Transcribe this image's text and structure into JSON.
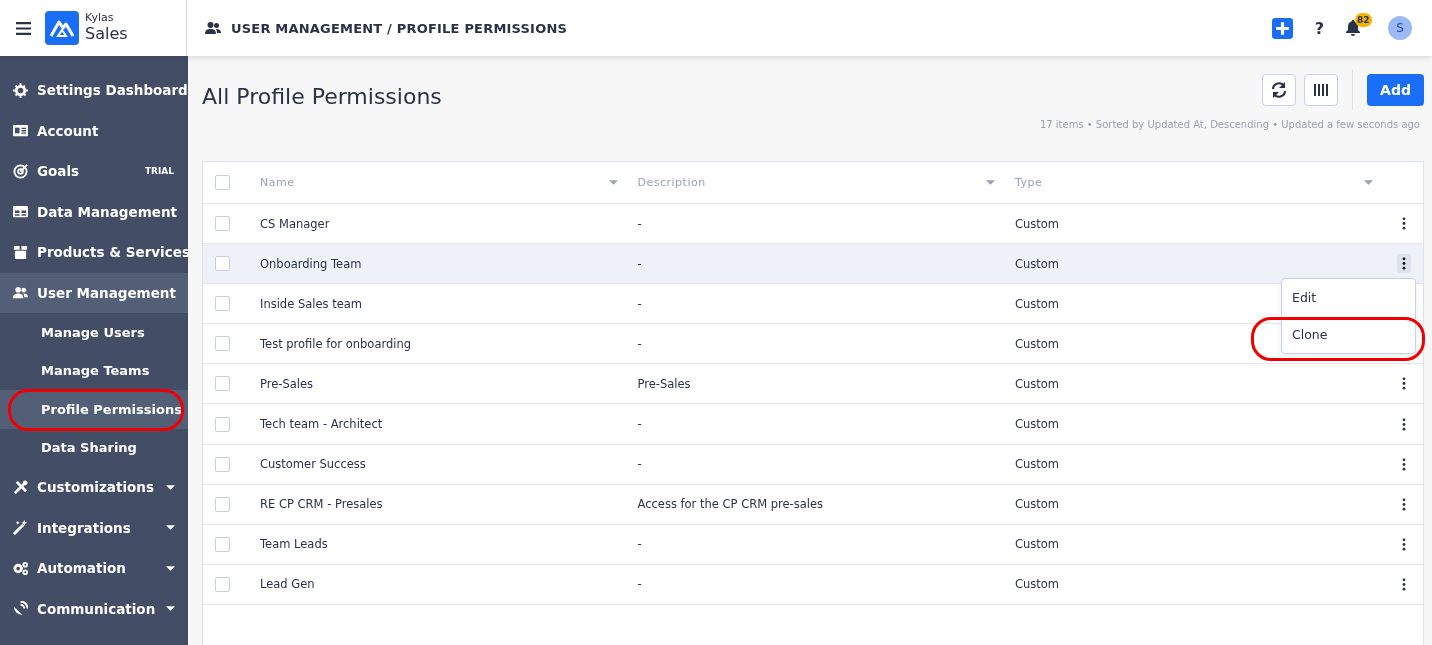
{
  "header": {
    "brand_top": "Kylas",
    "brand_bottom": "Sales",
    "breadcrumb": "USER MANAGEMENT / PROFILE PERMISSIONS",
    "help": "?",
    "notification_count": "82",
    "avatar": "S"
  },
  "sidebar": {
    "items": [
      {
        "kind": "link",
        "label": "Settings Dashboard",
        "expanded": false
      },
      {
        "kind": "link",
        "label": "Account",
        "expanded": false
      },
      {
        "kind": "link",
        "label": "Goals",
        "badge": "TRIAL",
        "expanded": false
      },
      {
        "kind": "group",
        "label": "Data Management",
        "expanded": false
      },
      {
        "kind": "link",
        "label": "Products & Services",
        "expanded": false
      },
      {
        "kind": "group",
        "label": "User Management",
        "expanded": true,
        "children": [
          {
            "label": "Manage Users",
            "selected": false,
            "circled": false
          },
          {
            "label": "Manage Teams",
            "selected": false,
            "circled": false
          },
          {
            "label": "Profile Permissions",
            "selected": true,
            "circled": true
          },
          {
            "label": "Data Sharing",
            "selected": false,
            "circled": false
          }
        ]
      },
      {
        "kind": "group",
        "label": "Customizations",
        "expanded": false
      },
      {
        "kind": "group",
        "label": "Integrations",
        "expanded": false
      },
      {
        "kind": "group",
        "label": "Automation",
        "expanded": false
      },
      {
        "kind": "group",
        "label": "Communication",
        "expanded": false
      }
    ]
  },
  "page": {
    "title": "All Profile Permissions",
    "add_button": "Add",
    "meta": "17 items • Sorted by Updated At, Descending • Updated a few seconds ago"
  },
  "table": {
    "all_checked": false,
    "columns": [
      "Name",
      "Description",
      "Type"
    ],
    "rows": [
      {
        "name": "CS Manager",
        "description": "-",
        "type": "Custom",
        "hovered": false,
        "checked": false,
        "menu_open": false
      },
      {
        "name": "Onboarding Team",
        "description": "-",
        "type": "Custom",
        "hovered": true,
        "checked": false,
        "menu_open": true
      },
      {
        "name": "Inside Sales team",
        "description": "-",
        "type": "Custom",
        "hovered": false,
        "checked": false,
        "menu_open": false
      },
      {
        "name": "Test profile for onboarding",
        "description": "-",
        "type": "Custom",
        "hovered": false,
        "checked": false,
        "menu_open": false
      },
      {
        "name": "Pre-Sales",
        "description": "Pre-Sales",
        "type": "Custom",
        "hovered": false,
        "checked": false,
        "menu_open": false
      },
      {
        "name": "Tech team - Architect",
        "description": "-",
        "type": "Custom",
        "hovered": false,
        "checked": false,
        "menu_open": false
      },
      {
        "name": "Customer Success",
        "description": "-",
        "type": "Custom",
        "hovered": false,
        "checked": false,
        "menu_open": false
      },
      {
        "name": "RE CP CRM - Presales",
        "description": "Access for the CP CRM pre-sales",
        "type": "Custom",
        "hovered": false,
        "checked": false,
        "menu_open": false
      },
      {
        "name": "Team Leads",
        "description": "-",
        "type": "Custom",
        "hovered": false,
        "checked": false,
        "menu_open": false
      },
      {
        "name": "Lead Gen",
        "description": "-",
        "type": "Custom",
        "hovered": false,
        "checked": false,
        "menu_open": false
      }
    ]
  },
  "row_menu": {
    "items": [
      {
        "label": "Edit",
        "circled": false
      },
      {
        "label": "Clone",
        "circled": true
      }
    ]
  }
}
